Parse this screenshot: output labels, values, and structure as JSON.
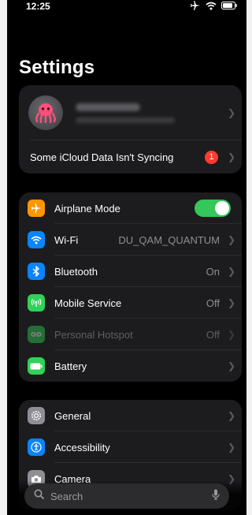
{
  "status_bar": {
    "time": "12:25",
    "icons": [
      "airplane-icon",
      "wifi-icon",
      "battery-icon"
    ]
  },
  "page": {
    "title": "Settings"
  },
  "profile": {
    "sync_warning": "Some iCloud Data Isn't Syncing",
    "badge_count": "1"
  },
  "connectivity": [
    {
      "label": "Airplane Mode",
      "icon": "airplane-icon",
      "color": "#ff9500",
      "toggle_on": true
    },
    {
      "label": "Wi-Fi",
      "value": "DU_QAM_QUANTUM",
      "icon": "wifi-icon",
      "color": "#0a84ff"
    },
    {
      "label": "Bluetooth",
      "value": "On",
      "icon": "bluetooth-icon",
      "color": "#0a84ff"
    },
    {
      "label": "Mobile Service",
      "value": "Off",
      "icon": "antenna-icon",
      "color": "#30d158"
    },
    {
      "label": "Personal Hotspot",
      "value": "Off",
      "icon": "hotspot-icon",
      "color": "#30d158",
      "disabled": true
    },
    {
      "label": "Battery",
      "icon": "battery-icon",
      "color": "#30d158"
    }
  ],
  "general": [
    {
      "label": "General",
      "icon": "gear-icon",
      "color": "#8e8e93"
    },
    {
      "label": "Accessibility",
      "icon": "accessibility-icon",
      "color": "#0a84ff"
    },
    {
      "label": "Camera",
      "icon": "camera-icon",
      "color": "#8e8e93"
    }
  ],
  "search": {
    "placeholder": "Search"
  },
  "colors": {
    "background": "#000000",
    "group": "#1c1c1e",
    "toggle_on": "#34c759",
    "badge": "#ff3b30"
  }
}
